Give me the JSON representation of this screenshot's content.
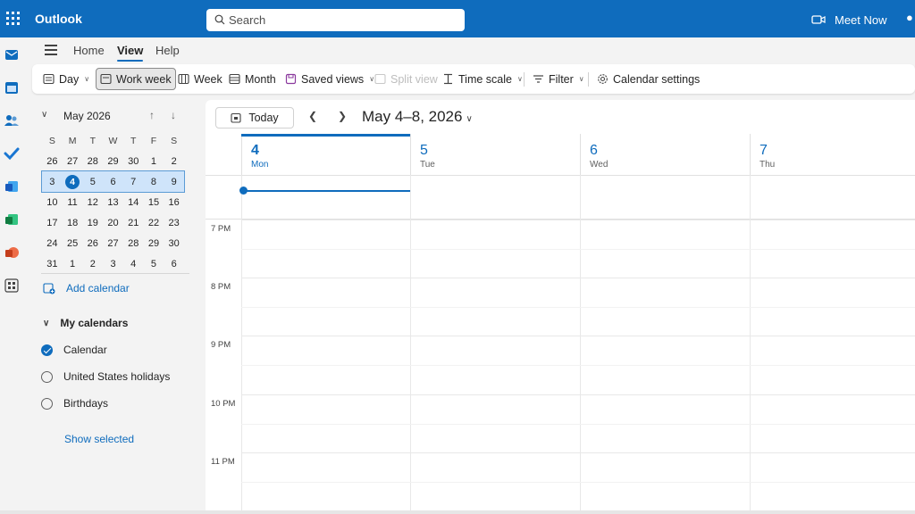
{
  "app": {
    "name": "Outlook",
    "colors": {
      "brand": "#0f6cbd",
      "selection": "#cfe4fa"
    }
  },
  "search": {
    "placeholder": "Search"
  },
  "topbar": {
    "meet_now": "Meet Now"
  },
  "rail": {
    "apps": [
      "mail-icon",
      "calendar-icon",
      "people-icon",
      "todo-icon",
      "word-icon",
      "excel-icon",
      "powerpoint-icon",
      "more-apps-icon"
    ]
  },
  "menu": {
    "tabs": [
      {
        "label": "Home",
        "active": false
      },
      {
        "label": "View",
        "active": true
      },
      {
        "label": "Help",
        "active": false
      }
    ]
  },
  "ribbon": {
    "day": "Day",
    "work_week": "Work week",
    "week": "Week",
    "month": "Month",
    "saved_views": "Saved views",
    "split_view": "Split view",
    "time_scale": "Time scale",
    "filter": "Filter",
    "calendar_settings": "Calendar settings"
  },
  "mini_calendar": {
    "title": "May 2026",
    "weekdays": [
      "S",
      "M",
      "T",
      "W",
      "T",
      "F",
      "S"
    ],
    "weeks": [
      [
        "26",
        "27",
        "28",
        "29",
        "30",
        "1",
        "2"
      ],
      [
        "3",
        "4",
        "5",
        "6",
        "7",
        "8",
        "9"
      ],
      [
        "10",
        "11",
        "12",
        "13",
        "14",
        "15",
        "16"
      ],
      [
        "17",
        "18",
        "19",
        "20",
        "21",
        "22",
        "23"
      ],
      [
        "24",
        "25",
        "26",
        "27",
        "28",
        "29",
        "30"
      ],
      [
        "31",
        "1",
        "2",
        "3",
        "4",
        "5",
        "6"
      ]
    ],
    "selected_week": 1,
    "today": "4"
  },
  "sidebar": {
    "add_calendar": "Add calendar",
    "my_calendars": "My calendars",
    "calendars": [
      {
        "label": "Calendar",
        "checked": true
      },
      {
        "label": "United States holidays",
        "checked": false
      },
      {
        "label": "Birthdays",
        "checked": false
      }
    ],
    "show_selected": "Show selected"
  },
  "calendar": {
    "today_label": "Today",
    "range_label": "May 4–8, 2026",
    "days": [
      {
        "num": "4",
        "name": "Mon",
        "current": true
      },
      {
        "num": "5",
        "name": "Tue",
        "current": false
      },
      {
        "num": "6",
        "name": "Wed",
        "current": false
      },
      {
        "num": "7",
        "name": "Thu",
        "current": false
      }
    ],
    "hours": [
      "7 PM",
      "8 PM",
      "9 PM",
      "10 PM",
      "11 PM"
    ]
  }
}
